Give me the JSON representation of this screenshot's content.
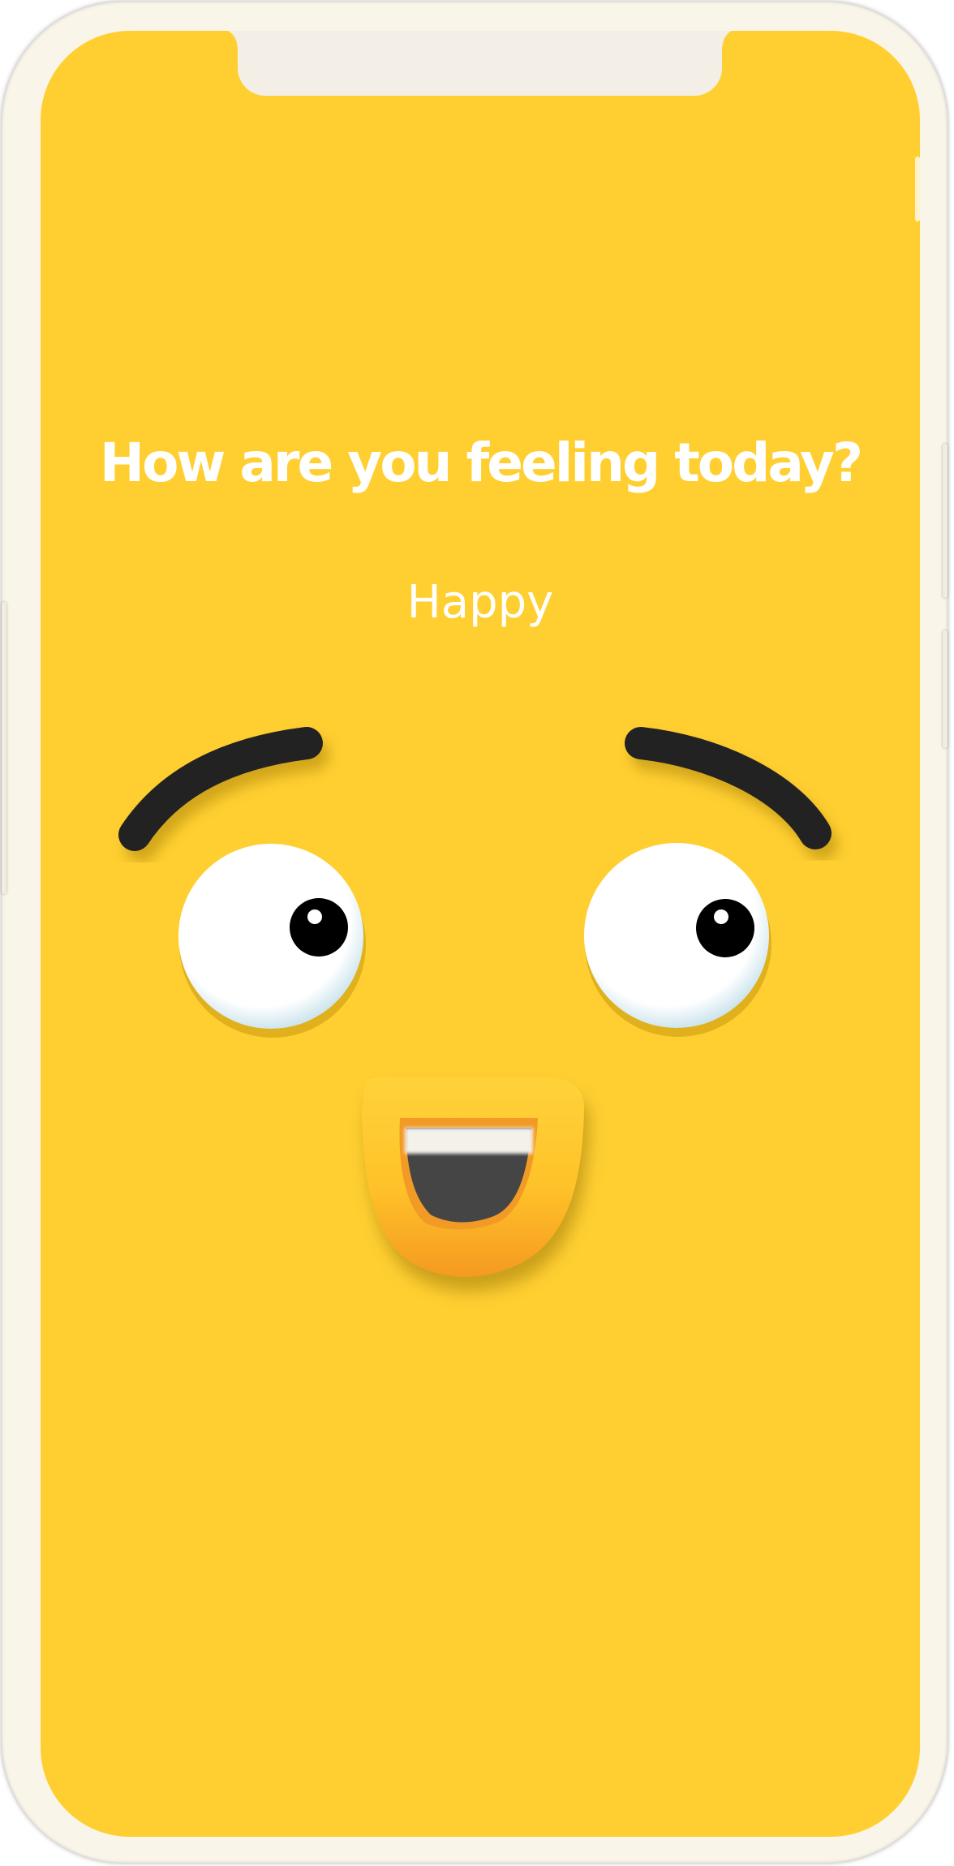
{
  "screen": {
    "question": "How are you feeling today?",
    "mood_label": "Happy"
  },
  "colors": {
    "background": "#ffcf31",
    "text": "#ffffff",
    "brow": "#222222",
    "eye_white": "#ffffff",
    "pupil": "#000000",
    "mouth": "#f7a12a",
    "mouth_inner": "#444444",
    "teeth": "#f4f0ea",
    "device_frame": "#faf5e9"
  },
  "icons": {
    "left_brow": "left-eyebrow-icon",
    "right_brow": "right-eyebrow-icon",
    "left_eye": "left-eye-icon",
    "right_eye": "right-eye-icon",
    "mouth": "mouth-icon"
  }
}
